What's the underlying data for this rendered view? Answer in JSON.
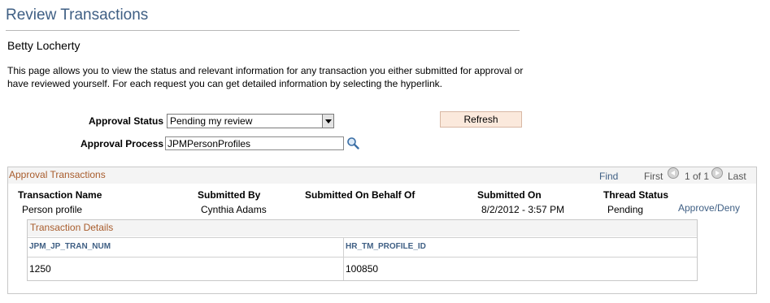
{
  "page": {
    "title": "Review Transactions",
    "user_name": "Betty Locherty",
    "intro_line1": "This page allows you to view the status and relevant information for any transaction you either submitted for approval or",
    "intro_line2": "have reviewed yourself. For each request you can get detailed information by selecting the hyperlink."
  },
  "filters": {
    "approval_status_label": "Approval Status",
    "approval_status_value": "Pending my review",
    "approval_process_label": "Approval Process",
    "approval_process_value": "JPMPersonProfiles",
    "refresh_label": "Refresh"
  },
  "grid": {
    "title": "Approval Transactions",
    "nav": {
      "find": "Find",
      "first": "First",
      "count": "1 of 1",
      "last": "Last"
    },
    "columns": [
      "Transaction Name",
      "Submitted By",
      "Submitted On Behalf Of",
      "Submitted On",
      "Thread Status"
    ],
    "rows": [
      {
        "transaction_name": "Person profile",
        "submitted_by": "Cynthia Adams",
        "on_behalf_of": "",
        "submitted_on": "8/2/2012 - 3:57 PM",
        "thread_status": "Pending",
        "action_link": "Approve/Deny"
      }
    ]
  },
  "details": {
    "title": "Transaction Details",
    "columns": [
      "JPM_JP_TRAN_NUM",
      "HR_TM_PROFILE_ID"
    ],
    "rows": [
      [
        "1250",
        "100850"
      ]
    ]
  },
  "icons": {
    "lookup": "magnifier-icon",
    "prev": "circle-left-arrow-icon",
    "next": "circle-right-arrow-icon",
    "dropdown": "dropdown-arrow-icon"
  },
  "colors": {
    "title": "#3f5f84",
    "section_title": "#a85c2c",
    "button_bg": "#fbe9dc"
  }
}
